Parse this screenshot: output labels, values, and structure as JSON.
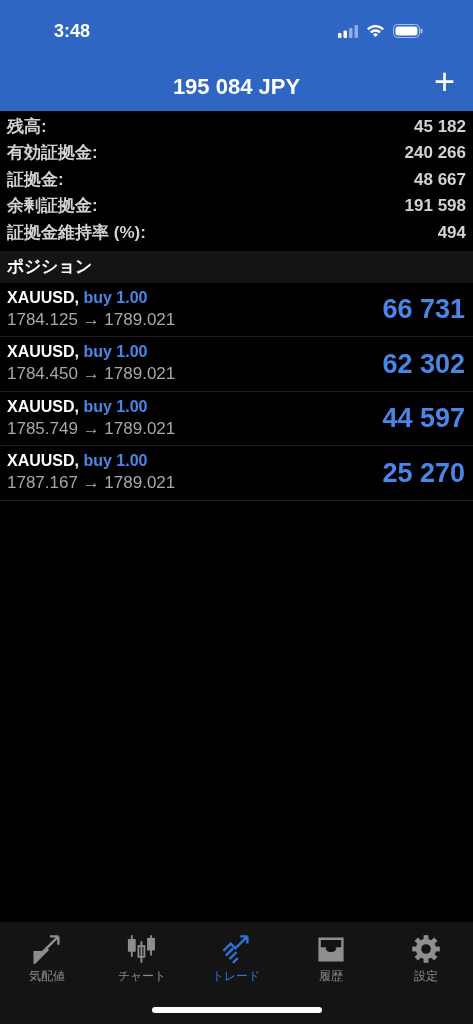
{
  "status_bar": {
    "time": "3:48"
  },
  "header": {
    "title": "195 084 JPY",
    "action": "+"
  },
  "summary": [
    {
      "label": "残高:",
      "value": "45 182"
    },
    {
      "label": "有効証拠金:",
      "value": "240 266"
    },
    {
      "label": "証拠金:",
      "value": "48 667"
    },
    {
      "label": "余剰証拠金:",
      "value": "191 598"
    },
    {
      "label": "証拠金維持率 (%):",
      "value": "494"
    }
  ],
  "section_title": "ポジション",
  "positions": [
    {
      "symbol": "XAUUSD,",
      "order": "buy 1.00",
      "prices": "1784.125 → 1789.021",
      "profit": "66 731"
    },
    {
      "symbol": "XAUUSD,",
      "order": "buy 1.00",
      "prices": "1784.450 → 1789.021",
      "profit": "62 302"
    },
    {
      "symbol": "XAUUSD,",
      "order": "buy 1.00",
      "prices": "1785.749 → 1789.021",
      "profit": "44 597"
    },
    {
      "symbol": "XAUUSD,",
      "order": "buy 1.00",
      "prices": "1787.167 → 1789.021",
      "profit": "25 270"
    }
  ],
  "tabs": [
    {
      "kind": "quotes",
      "label": "気配値",
      "selected": false
    },
    {
      "kind": "chart",
      "label": "チャート",
      "selected": false
    },
    {
      "kind": "trade",
      "label": "トレード",
      "selected": true
    },
    {
      "kind": "history",
      "label": "履歴",
      "selected": false
    },
    {
      "kind": "settings",
      "label": "設定",
      "selected": false
    }
  ]
}
